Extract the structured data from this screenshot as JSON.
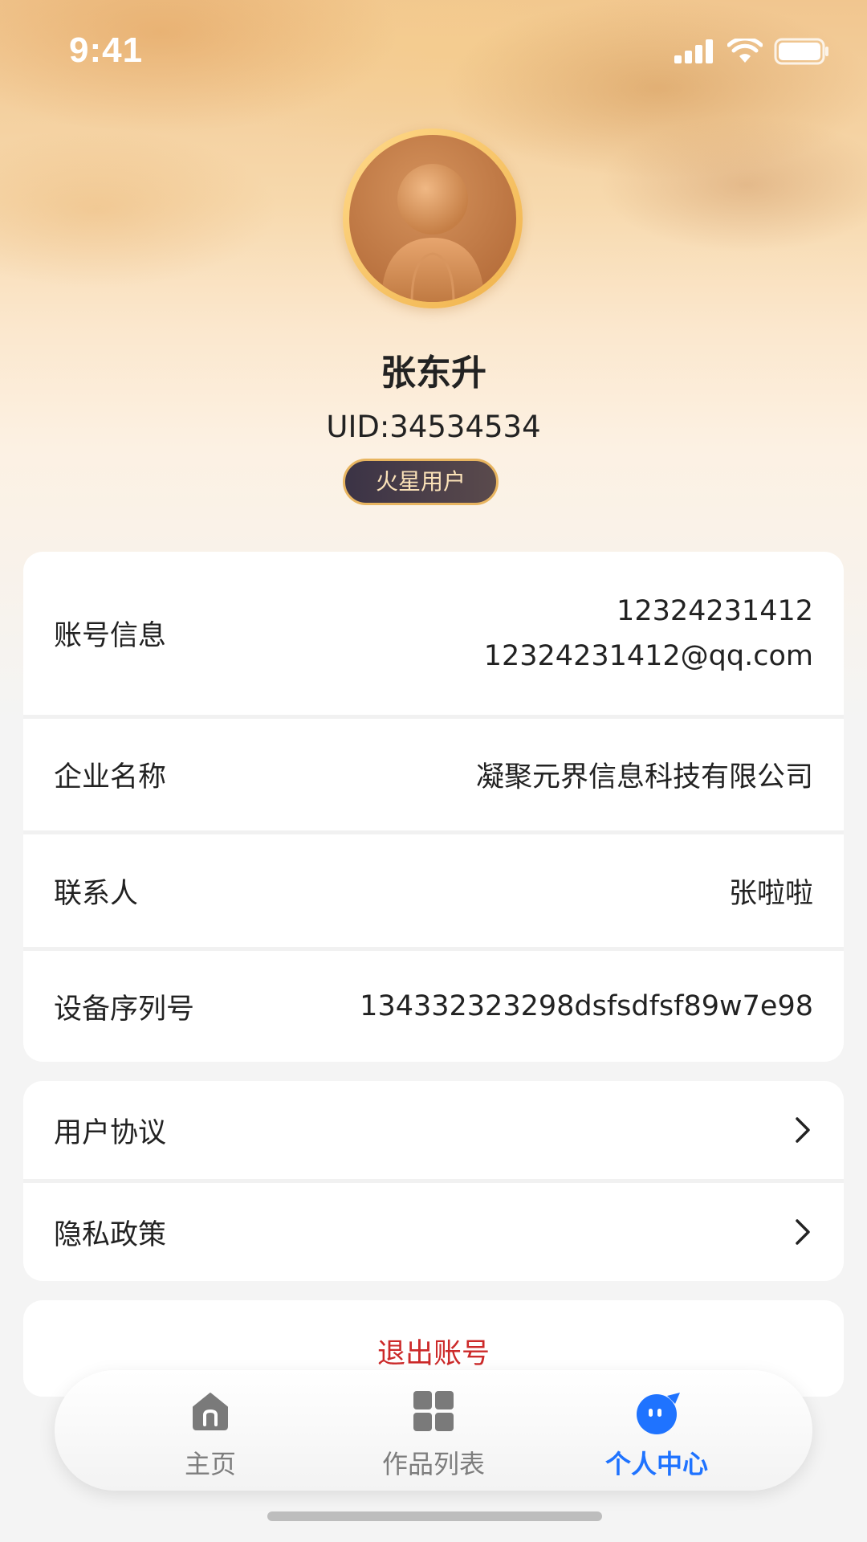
{
  "status_bar": {
    "time": "9:41",
    "icons": [
      "signal-icon",
      "wifi-icon",
      "battery-icon"
    ]
  },
  "profile": {
    "name": "张东升",
    "uid": "UID:34534534",
    "badge": "火星用户"
  },
  "info_card": {
    "account": {
      "label": "账号信息",
      "phone": "12324231412",
      "email": "12324231412@qq.com"
    },
    "company": {
      "label": "企业名称",
      "value": "凝聚元界信息科技有限公司"
    },
    "contact": {
      "label": "联系人",
      "value": "张啦啦"
    },
    "device": {
      "label": "设备序列号",
      "value": "134332323298dsfsdfsf89w7e98"
    }
  },
  "links_card": {
    "agreement": "用户协议",
    "privacy": "隐私政策"
  },
  "logout": {
    "label": "退出账号"
  },
  "tab_bar": {
    "tabs": [
      {
        "label": "主页",
        "icon": "home-icon",
        "active": false
      },
      {
        "label": "作品列表",
        "icon": "grid-icon",
        "active": false
      },
      {
        "label": "个人中心",
        "icon": "profile-chat-icon",
        "active": true
      }
    ]
  },
  "colors": {
    "accent": "#1f73ff",
    "logout": "#cc2a2a",
    "badge_border": "#e8b560"
  }
}
